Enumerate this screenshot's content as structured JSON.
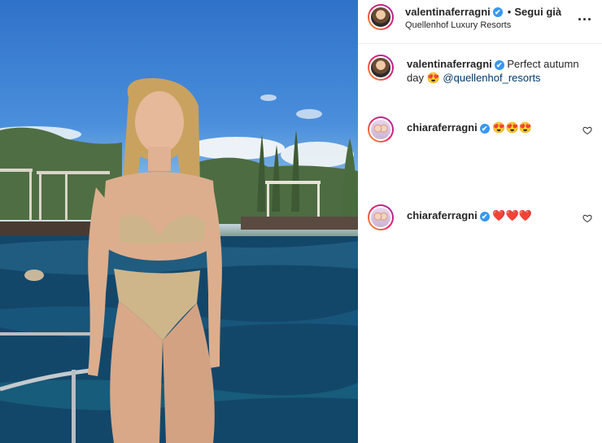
{
  "post": {
    "image_alt": "Woman in gold lingerie standing by a pool at a resort"
  },
  "header": {
    "username": "valentinaferragni",
    "verified_mark": "✔",
    "separator": "•",
    "follow_label": "Segui già",
    "location": "Quellenhof Luxury Resorts",
    "more_label": "..."
  },
  "caption": {
    "username": "valentinaferragni",
    "verified_mark": "✔",
    "text_line1": "Perfect autumn",
    "text_line2": "day",
    "emoji": "😍",
    "mention": "@quellenhof_resorts"
  },
  "comments": [
    {
      "username": "chiaraferragni",
      "verified_mark": "✔",
      "emoji": "😍😍😍"
    },
    {
      "username": "chiaraferragni",
      "verified_mark": "✔",
      "emoji": "❤️❤️❤️"
    }
  ],
  "colors": {
    "mention": "#00376b",
    "verified": "#3897f0",
    "text": "#262626"
  }
}
